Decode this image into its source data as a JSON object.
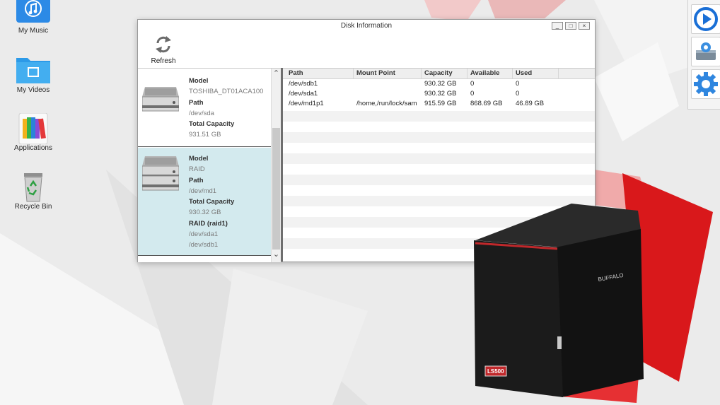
{
  "desktop": {
    "icons": [
      {
        "label": "My Music",
        "icon": "music-note-icon"
      },
      {
        "label": "My Videos",
        "icon": "film-folder-icon"
      },
      {
        "label": "Applications",
        "icon": "books-icon"
      },
      {
        "label": "Recycle Bin",
        "icon": "recycle-bin-icon"
      }
    ],
    "dock": [
      {
        "icon": "play-circle-icon"
      },
      {
        "icon": "disk-gear-icon"
      },
      {
        "icon": "settings-gear-icon"
      }
    ]
  },
  "window": {
    "title": "Disk Information",
    "controls": {
      "minimize": "_",
      "maximize": "□",
      "close": "×"
    },
    "toolbar": {
      "refresh_label": "Refresh",
      "refresh_icon": "refresh-arrows-icon"
    }
  },
  "disks": [
    {
      "selected": false,
      "fields": [
        {
          "key": "Model",
          "value": "TOSHIBA_DT01ACA100"
        },
        {
          "key": "Path",
          "value": "/dev/sda"
        },
        {
          "key": "Total Capacity",
          "value": "931.51 GB"
        }
      ]
    },
    {
      "selected": true,
      "fields": [
        {
          "key": "Model",
          "value": "RAID"
        },
        {
          "key": "Path",
          "value": "/dev/md1"
        },
        {
          "key": "Total Capacity",
          "value": "930.32 GB"
        },
        {
          "key": "RAID (raid1)",
          "value": "/dev/sda1"
        }
      ],
      "extra_value": "/dev/sdb1"
    }
  ],
  "scroll_arrows": {
    "up": "⌃",
    "down": "⌄"
  },
  "table": {
    "columns": [
      "Path",
      "Mount Point",
      "Capacity",
      "Available",
      "Used"
    ],
    "rows": [
      [
        "/dev/sdb1",
        "",
        "930.32 GB",
        "0",
        "0"
      ],
      [
        "/dev/sda1",
        "",
        "930.32 GB",
        "0",
        "0"
      ],
      [
        "/dev/md1p1",
        "/home,/run/lock/sam",
        "915.59 GB",
        "868.69 GB",
        "46.89 GB"
      ]
    ]
  },
  "nas": {
    "model_badge": "LS500",
    "brand": "BUFFALO"
  },
  "colors": {
    "accent_red": "#d9181b",
    "selection": "#d3eaee",
    "dock_blue": "#1a6fd6"
  }
}
